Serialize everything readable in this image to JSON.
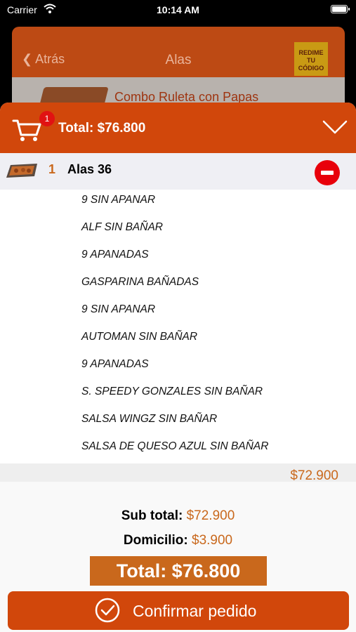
{
  "status_bar": {
    "carrier": "Carrier",
    "time": "10:14 AM"
  },
  "background": {
    "back_label": "Atrás",
    "title": "Alas",
    "logo_line1": "REDIME",
    "logo_line2": "TU CÓDIGO",
    "item_name": "Combo Ruleta con Papas"
  },
  "cart": {
    "badge_count": "1",
    "header_total": "Total: $76.800",
    "item": {
      "quantity": "1",
      "name": "Alas 36",
      "price": "$72.900",
      "modifiers": [
        "9 SIN APANAR",
        "ALF SIN BAÑAR",
        "9 APANADAS",
        "GASPARINA BAÑADAS",
        "9 SIN APANAR",
        "AUTOMAN SIN BAÑAR",
        "9 APANADAS",
        "S. SPEEDY GONZALES SIN BAÑAR",
        "SALSA WINGZ SIN BAÑAR",
        "SALSA DE QUESO AZUL SIN BAÑAR"
      ]
    },
    "subtotal_label": "Sub total:",
    "subtotal_value": "$72.900",
    "delivery_label": "Domicilio:",
    "delivery_value": "$3.900",
    "total_label": "Total: $76.800",
    "confirm_label": "Confirmar pedido"
  },
  "colors": {
    "accent": "#d1470b",
    "price": "#c9681c",
    "remove": "#e8000b"
  },
  "icons": [
    "wifi-icon",
    "battery-icon",
    "back-chevron-icon",
    "cart-icon",
    "chevron-down-icon",
    "remove-icon",
    "checkmark-circle-icon"
  ]
}
